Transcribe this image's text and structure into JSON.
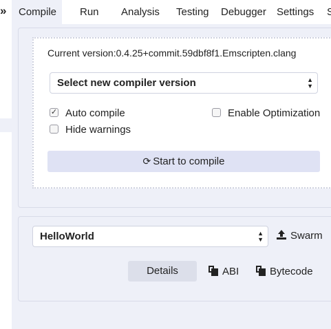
{
  "tabs": [
    {
      "label": "Compile",
      "active": true
    },
    {
      "label": "Run",
      "active": false
    },
    {
      "label": "Analysis",
      "active": false
    },
    {
      "label": "Testing",
      "active": false
    },
    {
      "label": "Debugger",
      "active": false
    },
    {
      "label": "Settings",
      "active": false
    },
    {
      "label": "Support",
      "active": false
    }
  ],
  "icons": {
    "collapse": "double-chevron-right-icon",
    "refresh": "refresh-icon",
    "upload": "upload-icon",
    "copy": "copy-icon"
  },
  "glyphs": {
    "collapse": "»",
    "check": "✓",
    "refresh": "⟳",
    "arrow_up": "▲",
    "arrow_down": "▼"
  },
  "compiler": {
    "current_version": "Current version:0.4.25+commit.59dbf8f1.Emscripten.clang",
    "select_placeholder": "Select new compiler version",
    "auto_compile_label": "Auto compile",
    "auto_compile_checked": true,
    "enable_optimization_label": "Enable Optimization",
    "enable_optimization_checked": false,
    "hide_warnings_label": "Hide warnings",
    "hide_warnings_checked": false,
    "compile_button_label": "Start to compile"
  },
  "contract": {
    "selected": "HelloWorld",
    "swarm_label": "Swarm",
    "details_label": "Details",
    "abi_label": "ABI",
    "bytecode_label": "Bytecode"
  },
  "colors": {
    "background": "#eef0f8",
    "compile_button": "#dfe2f4",
    "details_button": "#dcdfea"
  }
}
